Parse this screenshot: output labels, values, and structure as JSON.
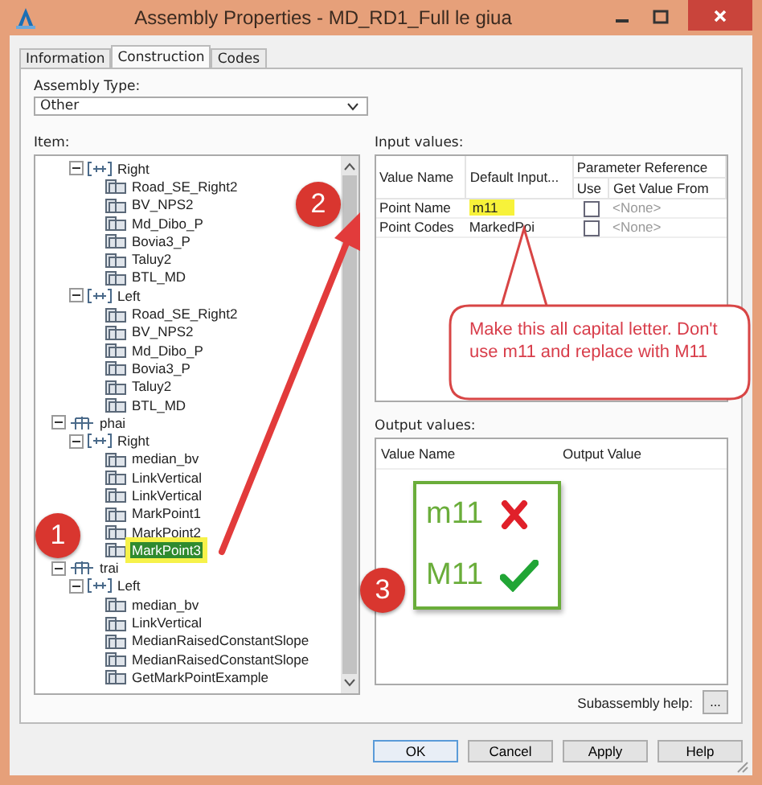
{
  "window": {
    "title": "Assembly Properties - MD_RD1_Full le giua"
  },
  "tabs": [
    {
      "label": "Information",
      "selected": false
    },
    {
      "label": "Construction",
      "selected": true
    },
    {
      "label": "Codes",
      "selected": false
    }
  ],
  "assembly_type": {
    "label": "Assembly Type:",
    "value": "Other"
  },
  "item": {
    "label": "Item:",
    "continued": [
      {
        "label": "Right",
        "kind": "group",
        "expanded": true,
        "selected": false,
        "children": [
          {
            "label": "Road_SE_Right2",
            "kind": "sub",
            "selected": false
          },
          {
            "label": "BV_NPS2",
            "kind": "sub",
            "selected": false
          },
          {
            "label": "Md_Dibo_P",
            "kind": "sub",
            "selected": false
          },
          {
            "label": "Bovia3_P",
            "kind": "sub",
            "selected": false
          },
          {
            "label": "Taluy2",
            "kind": "sub",
            "selected": false
          },
          {
            "label": "BTL_MD",
            "kind": "sub",
            "selected": false
          }
        ]
      },
      {
        "label": "Left",
        "kind": "group",
        "expanded": true,
        "selected": false,
        "children": [
          {
            "label": "Road_SE_Right2",
            "kind": "sub",
            "selected": false
          },
          {
            "label": "BV_NPS2",
            "kind": "sub",
            "selected": false
          },
          {
            "label": "Md_Dibo_P",
            "kind": "sub",
            "selected": false
          },
          {
            "label": "Bovia3_P",
            "kind": "sub",
            "selected": false
          },
          {
            "label": "Taluy2",
            "kind": "sub",
            "selected": false
          },
          {
            "label": "BTL_MD",
            "kind": "sub",
            "selected": false
          }
        ]
      }
    ],
    "items": [
      {
        "label": "phai",
        "kind": "assembly",
        "expanded": true,
        "selected": false,
        "children": [
          {
            "label": "Right",
            "kind": "group",
            "expanded": true,
            "selected": false,
            "children": [
              {
                "label": "median_bv",
                "kind": "sub",
                "selected": false
              },
              {
                "label": "LinkVertical",
                "kind": "sub",
                "selected": false
              },
              {
                "label": "LinkVertical",
                "kind": "sub",
                "selected": false
              },
              {
                "label": "MarkPoint1",
                "kind": "sub",
                "selected": false
              },
              {
                "label": "MarkPoint2",
                "kind": "sub",
                "selected": false
              },
              {
                "label": "MarkPoint3",
                "kind": "sub",
                "selected": true
              }
            ]
          }
        ]
      },
      {
        "label": "trai",
        "kind": "assembly",
        "expanded": true,
        "selected": false,
        "children": [
          {
            "label": "Left",
            "kind": "group",
            "expanded": true,
            "selected": false,
            "children": [
              {
                "label": "median_bv",
                "kind": "sub",
                "selected": false
              },
              {
                "label": "LinkVertical",
                "kind": "sub",
                "selected": false
              },
              {
                "label": "MedianRaisedConstantSlope",
                "kind": "sub",
                "selected": false
              },
              {
                "label": "MedianRaisedConstantSlope",
                "kind": "sub",
                "selected": false
              },
              {
                "label": "GetMarkPointExample",
                "kind": "sub",
                "selected": false
              }
            ]
          }
        ]
      }
    ]
  },
  "input_values": {
    "label": "Input values:",
    "columns": [
      "Value Name",
      "Default Input...",
      "Parameter Reference",
      "Use",
      "Get Value From"
    ],
    "rows": [
      {
        "name": "Point Name",
        "default": "m11",
        "highlighted": true,
        "use": false,
        "from": "<None>"
      },
      {
        "name": "Point Codes",
        "default": "MarkedPoi",
        "highlighted": false,
        "use": false,
        "from": "<None>"
      }
    ]
  },
  "output_values": {
    "label": "Output values:",
    "columns": [
      "Value Name",
      "Output Value"
    ]
  },
  "subassembly_help": {
    "label": "Subassembly help:",
    "button": "..."
  },
  "buttons": [
    {
      "label": "OK",
      "default": true
    },
    {
      "label": "Cancel",
      "default": false
    },
    {
      "label": "Apply",
      "default": false
    },
    {
      "label": "Help",
      "default": false
    }
  ],
  "annotations": {
    "markers": [
      "1",
      "2",
      "3"
    ],
    "callout": "Make this all capital letter. Don't use m11 and replace with M11",
    "comparison": [
      {
        "text": "m11",
        "kind": "wrong"
      },
      {
        "text": "M11",
        "kind": "right"
      }
    ]
  }
}
